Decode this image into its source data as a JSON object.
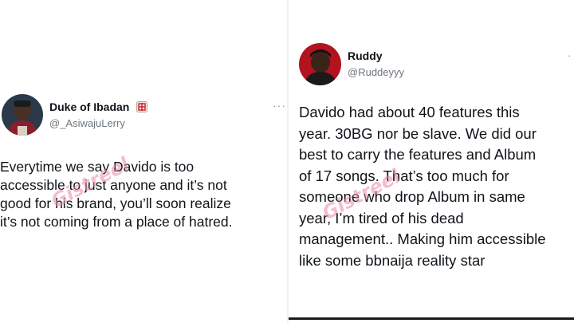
{
  "left_tweet": {
    "display_name": "Duke of Ibadan",
    "handle": "@_AsiwajuLerry",
    "badge_icon": "mahjong-tile-icon",
    "more_label": "···",
    "body": "Everytime we say Davido is too accessible to just anyone and it’s not good for his brand, you’ll soon realize it’s not coming from a place of hatred.",
    "lines": [
      "Everytime we say Davido is too",
      "accessible to just anyone and it’s not",
      "good for his brand, you’ll soon realize",
      "it’s not coming from a place of hatred."
    ]
  },
  "right_tweet": {
    "display_name": "Ruddy",
    "handle": "@Ruddeyyy",
    "more_label": "·",
    "lines": [
      "Davido had about 40 features this",
      "year. 30BG nor be slave. We did our",
      "best to carry the features and Album",
      "of 17 songs. That’s too much for",
      "someone who drop Album in same",
      "year, I’m tired of his dead",
      "management.. Making him accessible",
      "like some bbnaija reality star"
    ]
  },
  "watermark_text": "Gistreel",
  "colors": {
    "text": "#0f1419",
    "secondary": "#6e767d",
    "watermark": "#e88aa8",
    "badge_red": "#c8102e"
  }
}
